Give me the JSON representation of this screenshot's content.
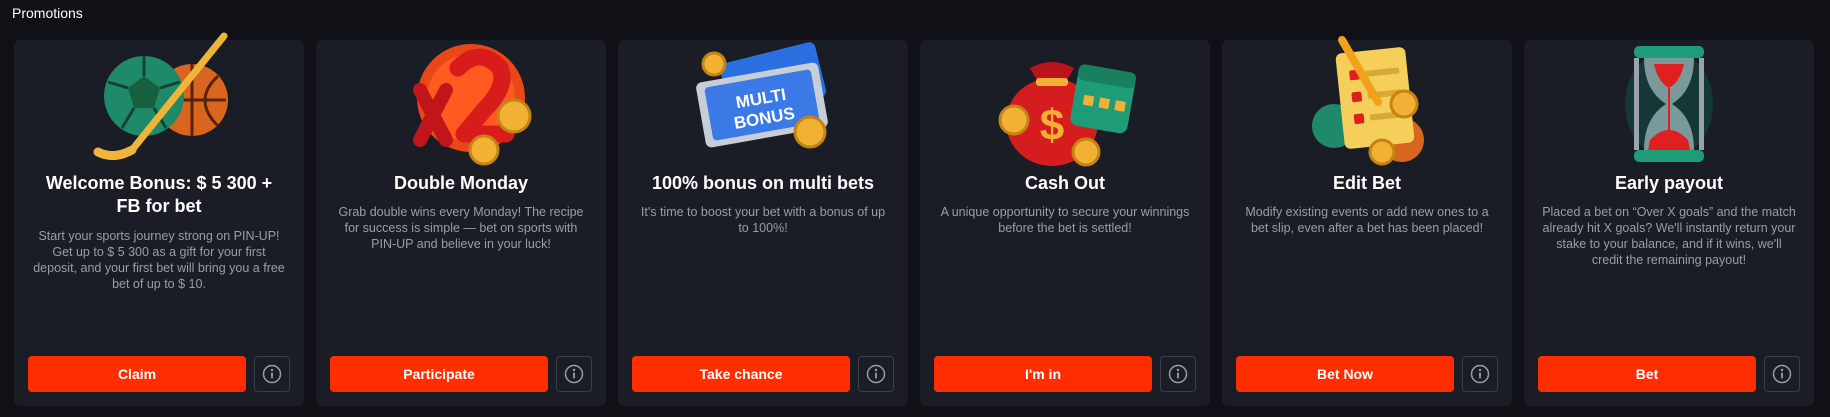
{
  "section": {
    "title": "Promotions"
  },
  "colors": {
    "background": "#0f1117",
    "card": "#1a1d26",
    "accent": "#ff2d00"
  },
  "cards": [
    {
      "icon": "sports-balls-icon",
      "title": "Welcome Bonus: $ 5 300 + FB for bet",
      "description": "Start your sports journey strong on PIN-UP! Get up to $ 5 300 as a gift for your first deposit, and your first bet will bring you a free bet of up to $ 10.",
      "button": "Claim",
      "info_icon": "info-icon"
    },
    {
      "icon": "x2-multiplier-icon",
      "title": "Double Monday",
      "description": "Grab double wins every Monday! The recipe for success is simple — bet on sports with PIN-UP and believe in your luck!",
      "button": "Participate",
      "info_icon": "info-icon"
    },
    {
      "icon": "multi-bonus-ticket-icon",
      "art_text": "MULTI BONUS",
      "title": "100% bonus on multi bets",
      "description": "It's time to boost your bet with a bonus of up to 100%!",
      "button": "Take chance",
      "info_icon": "info-icon"
    },
    {
      "icon": "money-bag-calendar-icon",
      "title": "Cash Out",
      "description": "A unique opportunity to secure your winnings before the bet is settled!",
      "button": "I'm in",
      "info_icon": "info-icon"
    },
    {
      "icon": "bet-slip-edit-icon",
      "title": "Edit Bet",
      "description": "Modify existing events or add new ones to a bet slip, even after a bet has been placed!",
      "button": "Bet Now",
      "info_icon": "info-icon"
    },
    {
      "icon": "hourglass-icon",
      "title": "Early payout",
      "description": "Placed a bet on “Over X goals” and the match already hit X goals? We'll instantly return your stake to your balance, and if it wins, we'll credit the remaining payout!",
      "button": "Bet",
      "info_icon": "info-icon"
    }
  ]
}
